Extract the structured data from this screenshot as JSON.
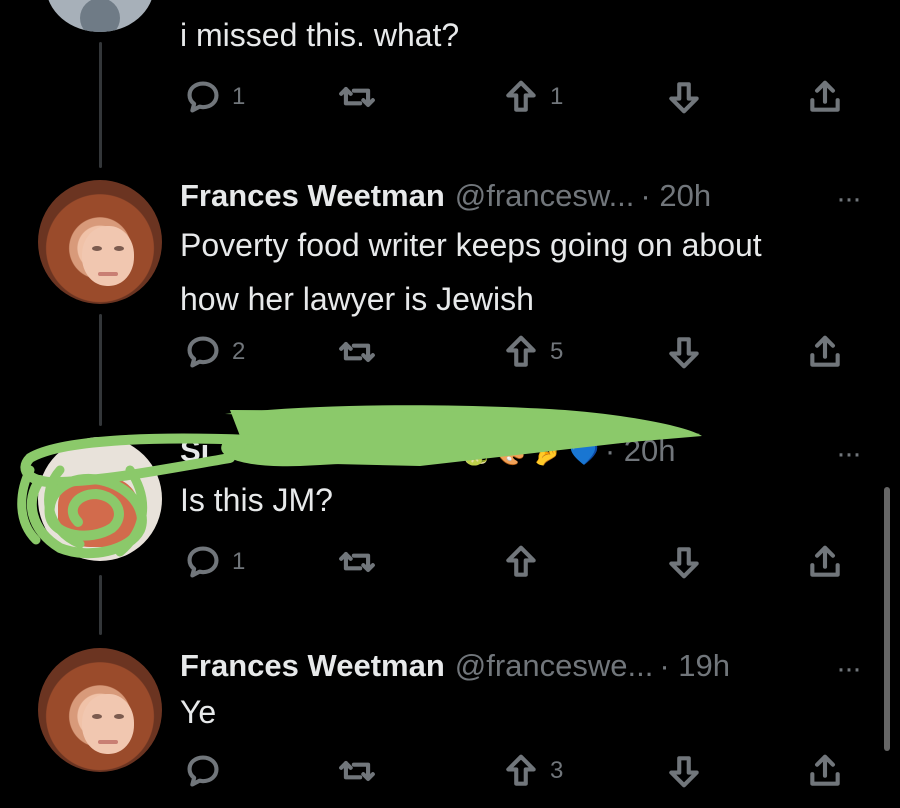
{
  "posts": [
    {
      "text": "i missed this. what?",
      "reply_count": "1",
      "retweet_count": "",
      "upvote_count": "1"
    },
    {
      "name": "Frances Weetman",
      "handle": "@francesw...",
      "time": "· 20h",
      "more": "···",
      "text": "Poverty food writer keeps going on about\nhow her lawyer is Jewish",
      "reply_count": "2",
      "retweet_count": "",
      "upvote_count": "5"
    },
    {
      "name": "Si",
      "time": "· 20h",
      "more": "···",
      "text": "Is this JM?",
      "reply_count": "1",
      "retweet_count": "",
      "upvote_count": ""
    },
    {
      "name": "Frances Weetman",
      "handle": "@franceswe...",
      "time": "· 19h",
      "more": "···",
      "text": "Ye",
      "reply_count": "",
      "retweet_count": "",
      "upvote_count": "3"
    }
  ],
  "colors": {
    "background": "#000000",
    "text": "#e7e9ea",
    "secondary": "#71767b",
    "scribble": "#8bc96a"
  },
  "icons": [
    "reply-icon",
    "retweet-icon",
    "upvote-icon",
    "downvote-icon",
    "share-icon",
    "more-icon"
  ]
}
